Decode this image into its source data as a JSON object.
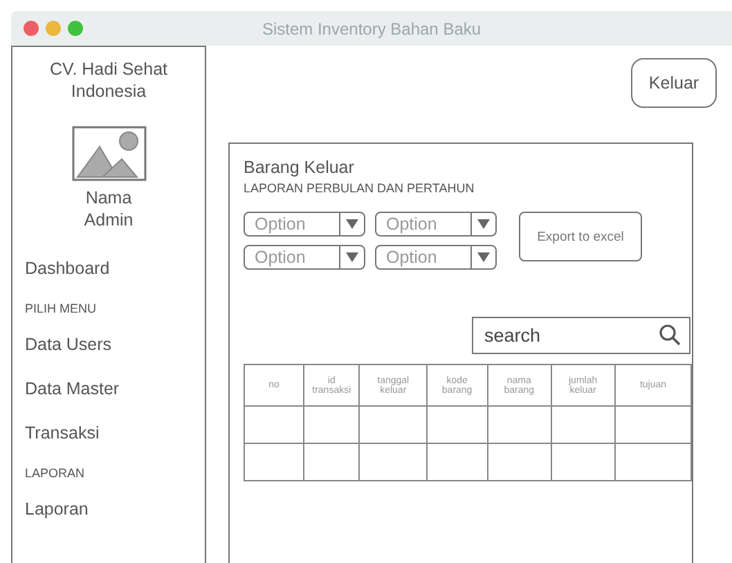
{
  "window": {
    "title": "Sistem Inventory Bahan Baku"
  },
  "sidebar": {
    "company": "CV. Hadi Sehat Indonesia",
    "user": "Nama Admin",
    "items": [
      {
        "kind": "item",
        "label": "Dashboard"
      },
      {
        "kind": "header",
        "label": "PILIH MENU"
      },
      {
        "kind": "item",
        "label": "Data Users"
      },
      {
        "kind": "item",
        "label": "Data Master"
      },
      {
        "kind": "item",
        "label": "Transaksi"
      },
      {
        "kind": "header",
        "label": "LAPORAN"
      },
      {
        "kind": "item",
        "label": "Laporan"
      }
    ]
  },
  "logout_button": "Keluar",
  "panel": {
    "title": "Barang Keluar",
    "subtitle": "LAPORAN PERBULAN DAN PERTAHUN",
    "dropdowns": [
      {
        "value": "Option"
      },
      {
        "value": "Option"
      },
      {
        "value": "Option"
      },
      {
        "value": "Option"
      }
    ],
    "export_button": "Export to excel",
    "search": {
      "placeholder": "search"
    },
    "table": {
      "columns": [
        "no",
        "id transaksi",
        "tanggal keluar",
        "kode barang",
        "nama barang",
        "jumlah keluar",
        "tujuan"
      ]
    }
  }
}
